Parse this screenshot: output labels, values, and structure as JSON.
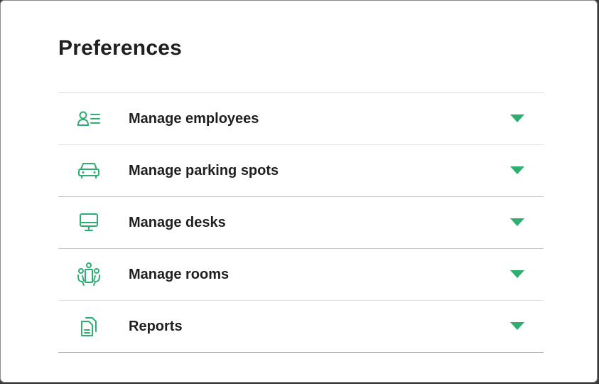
{
  "page": {
    "title": "Preferences"
  },
  "accent_color": "#2fae72",
  "sections": [
    {
      "label": "Manage employees",
      "icon": "employee-list-icon",
      "expanded": false
    },
    {
      "label": "Manage parking spots",
      "icon": "car-icon",
      "expanded": false
    },
    {
      "label": "Manage desks",
      "icon": "desktop-monitor-icon",
      "expanded": false
    },
    {
      "label": "Manage rooms",
      "icon": "meeting-room-icon",
      "expanded": false
    },
    {
      "label": "Reports",
      "icon": "documents-icon",
      "expanded": false
    }
  ]
}
